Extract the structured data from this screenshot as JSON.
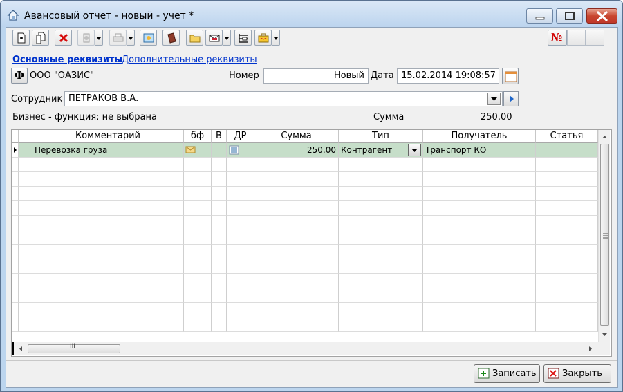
{
  "window": {
    "title": "Авансовый отчет - новый -  учет *"
  },
  "toolbar": {
    "icons": [
      "new-doc-icon",
      "copy-doc-icon",
      "delete-icon",
      "copy-dropdown-icon",
      "print-icon",
      "refresh-icon",
      "book-icon",
      "folder-icon",
      "mail-icon",
      "structure-icon",
      "briefcase-icon",
      "number-icon"
    ],
    "number_label": "№"
  },
  "tabs": {
    "main": "Основные реквизиты",
    "additional": "Дополнительные реквизиты "
  },
  "header": {
    "org_button": "Ф",
    "org_name": "ООО \"ОАЗИС\"",
    "number_label": "Номер",
    "number_value": "Новый",
    "date_label": "Дата",
    "date_value": "15.02.2014 19:08:57"
  },
  "employee": {
    "label": "Сотрудник",
    "value": "ПЕТРАКОВ В.А."
  },
  "summary": {
    "business_function": "Бизнес - функция: не выбрана",
    "sum_label": "Сумма",
    "sum_value": "250.00"
  },
  "table": {
    "columns": [
      "Комментарий",
      "бф",
      "В",
      "ДР",
      "Сумма",
      "Тип",
      "Получатель",
      "Статья"
    ],
    "rows": [
      {
        "comment": "Перевозка груза",
        "sum": "250.00",
        "type": "Контрагент",
        "recipient": "Транспорт КО"
      }
    ],
    "scroll_grip": "III"
  },
  "buttons": {
    "save": "Записать",
    "close": "Закрыть"
  },
  "colors": {
    "selected_row": "#c6dec9",
    "link": "#0033cc",
    "close_button": "#c8462f"
  }
}
